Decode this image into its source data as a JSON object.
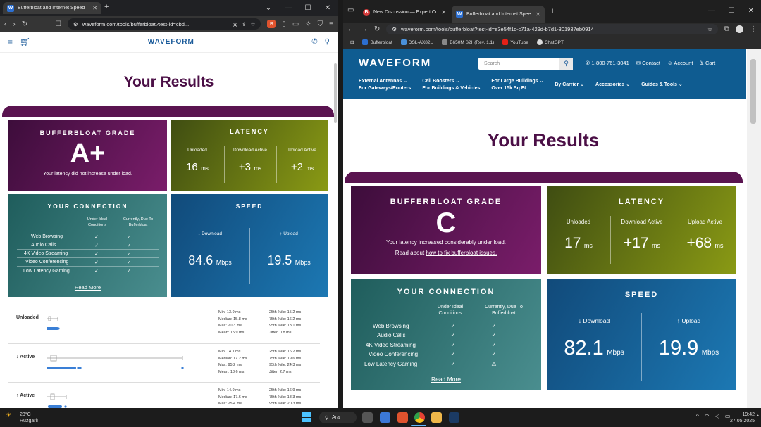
{
  "left_window": {
    "tab_title": "Bufferbloat and Internet Speed",
    "url": "waveform.com/tools/bufferbloat?test-id=cbd...",
    "site_logo": "WAVEFORM",
    "page_title": "Your Results",
    "grade": {
      "header": "BUFFERBLOAT GRADE",
      "value": "A+",
      "note": "Your latency did not increase under load."
    },
    "latency": {
      "header": "LATENCY",
      "cols": [
        {
          "label": "Unloaded",
          "value": "16",
          "unit": "ms"
        },
        {
          "label": "Download Active",
          "value": "+3",
          "unit": "ms"
        },
        {
          "label": "Upload Active",
          "value": "+2",
          "unit": "ms"
        }
      ]
    },
    "connection": {
      "header": "YOUR CONNECTION",
      "col1": "Under Ideal Conditions",
      "col2": "Currently, Due To Bufferbloat",
      "rows": [
        {
          "name": "Web Browsing",
          "ideal": "✓",
          "current": "✓"
        },
        {
          "name": "Audio Calls",
          "ideal": "✓",
          "current": "✓"
        },
        {
          "name": "4K Video Streaming",
          "ideal": "✓",
          "current": "✓"
        },
        {
          "name": "Video Conferencing",
          "ideal": "✓",
          "current": "✓"
        },
        {
          "name": "Low Latency Gaming",
          "ideal": "✓",
          "current": "✓"
        }
      ],
      "read_more": "Read More"
    },
    "speed": {
      "header": "SPEED",
      "download_label": "↓ Download",
      "download_value": "84.6",
      "upload_label": "↑ Upload",
      "upload_value": "19.5",
      "unit": "Mbps"
    },
    "details": [
      {
        "label": "Unloaded",
        "left": [
          "Min: 13.9 ms",
          "Median: 15.8 ms",
          "Max: 20.3 ms",
          "Mean: 15.9 ms"
        ],
        "right": [
          "25th %ile: 15.2 ms",
          "75th %ile: 16.2 ms",
          "95th %ile: 18.1 ms",
          "Jitter: 0.8 ms"
        ]
      },
      {
        "label": "↓ Active",
        "left": [
          "Min: 14.1 ms",
          "Median: 17.2 ms",
          "Max: 95.2 ms",
          "Mean: 18.6 ms"
        ],
        "right": [
          "25th %ile: 16.2 ms",
          "75th %ile: 19.6 ms",
          "95th %ile: 24.3 ms",
          "Jitter: 2.7 ms"
        ]
      },
      {
        "label": "↑ Active",
        "left": [
          "Min: 14.9 ms",
          "Median: 17.6 ms",
          "Max: 25.4 ms"
        ],
        "right": [
          "25th %ile: 16.9 ms",
          "75th %ile: 18.3 ms",
          "95th %ile: 20.3 ms"
        ]
      }
    ]
  },
  "right_window": {
    "tabs": [
      "New Discussion — Expert Comm",
      "Bufferbloat and Internet Speed"
    ],
    "url": "waveform.com/tools/bufferbloat?test-id=e3e54f1c-c71a-429d-b7d1-301937eb0914",
    "bookmarks": [
      "Bufferbloat",
      "DSL-AX82U",
      "B650M S2H(Rev. 1.1)",
      "YouTube",
      "ChatGPT"
    ],
    "site_logo": "WAVEFORM",
    "search_placeholder": "Search",
    "phone": "1-800-761-3041",
    "contact": "Contact",
    "account": "Account",
    "cart": "Cart",
    "menu": [
      {
        "l1": "External Antennas",
        "l2": "For Gateways/Routers"
      },
      {
        "l1": "Cell Boosters",
        "l2": "For Buildings & Vehicles"
      },
      {
        "l1": "For Large Buildings",
        "l2": "Over 15k Sq Ft"
      },
      {
        "l1": "By Carrier",
        "l2": ""
      },
      {
        "l1": "Accessories",
        "l2": ""
      },
      {
        "l1": "Guides & Tools",
        "l2": ""
      }
    ],
    "page_title": "Your Results",
    "grade": {
      "header": "BUFFERBLOAT GRADE",
      "value": "C",
      "note": "Your latency increased considerably under load.",
      "link_prefix": "Read about ",
      "link": "how to fix bufferbloat issues."
    },
    "latency": {
      "header": "LATENCY",
      "cols": [
        {
          "label": "Unloaded",
          "value": "17",
          "unit": "ms"
        },
        {
          "label": "Download Active",
          "value": "+17",
          "unit": "ms"
        },
        {
          "label": "Upload Active",
          "value": "+68",
          "unit": "ms"
        }
      ]
    },
    "connection": {
      "header": "YOUR CONNECTION",
      "col1": "Under Ideal Conditions",
      "col2": "Currently, Due To Bufferbloat",
      "rows": [
        {
          "name": "Web Browsing",
          "ideal": "✓",
          "current": "✓"
        },
        {
          "name": "Audio Calls",
          "ideal": "✓",
          "current": "✓"
        },
        {
          "name": "4K Video Streaming",
          "ideal": "✓",
          "current": "✓"
        },
        {
          "name": "Video Conferencing",
          "ideal": "✓",
          "current": "✓"
        },
        {
          "name": "Low Latency Gaming",
          "ideal": "✓",
          "current": "⚠"
        }
      ],
      "read_more": "Read More"
    },
    "speed": {
      "header": "SPEED",
      "download_label": "↓ Download",
      "download_value": "82.1",
      "upload_label": "↑ Upload",
      "upload_value": "19.9",
      "unit": "Mbps"
    }
  },
  "taskbar": {
    "weather_temp": "23°C",
    "weather_desc": "Rüzgarlı",
    "search": "Ara",
    "time": "19:42",
    "date": "27.05.2025"
  }
}
